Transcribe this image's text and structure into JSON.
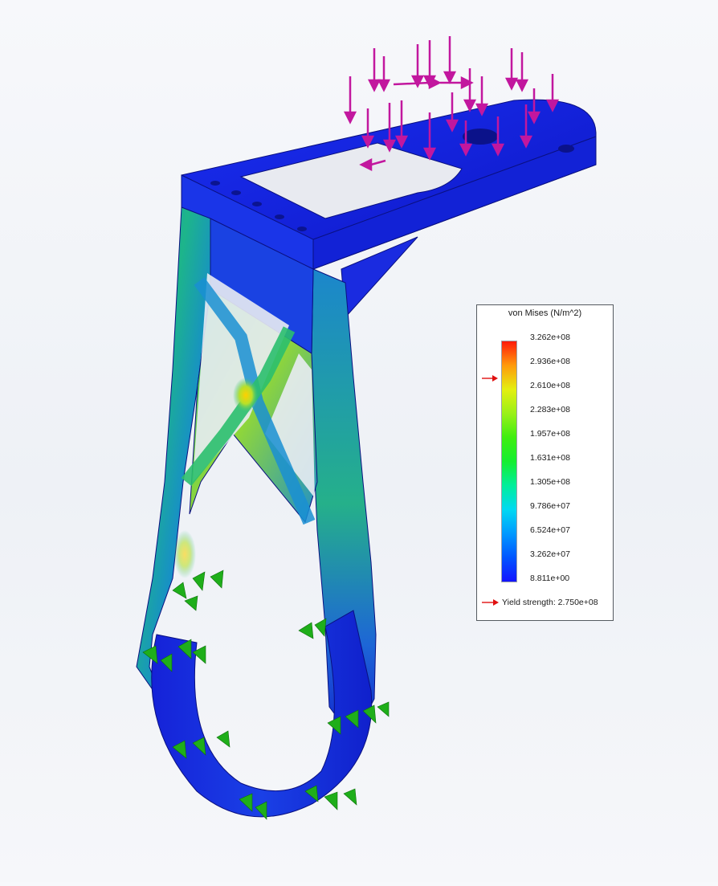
{
  "legend": {
    "title": "von Mises (N/m^2)",
    "ticks": [
      "3.262e+08",
      "2.936e+08",
      "2.610e+08",
      "2.283e+08",
      "1.957e+08",
      "1.631e+08",
      "1.305e+08",
      "9.786e+07",
      "6.524e+07",
      "3.262e+07",
      "8.811e+00"
    ],
    "yield_label": "Yield strength: 2.750e+08",
    "max_value": 326200000,
    "min_value": 8.811,
    "yield_value": 275000000
  },
  "colors": {
    "low_stress": "#1a22e0",
    "mid_stress": "#2bd17a",
    "high_stress": "#f0e020",
    "load_arrows": "#c2179e",
    "fixtures": "#1fae1a",
    "yield_marker": "#e01010"
  },
  "scene": {
    "model": "bracket-stress-plot",
    "load_icon": "downward-force-arrow-icon",
    "fixture_icon": "fixed-geometry-icon"
  }
}
